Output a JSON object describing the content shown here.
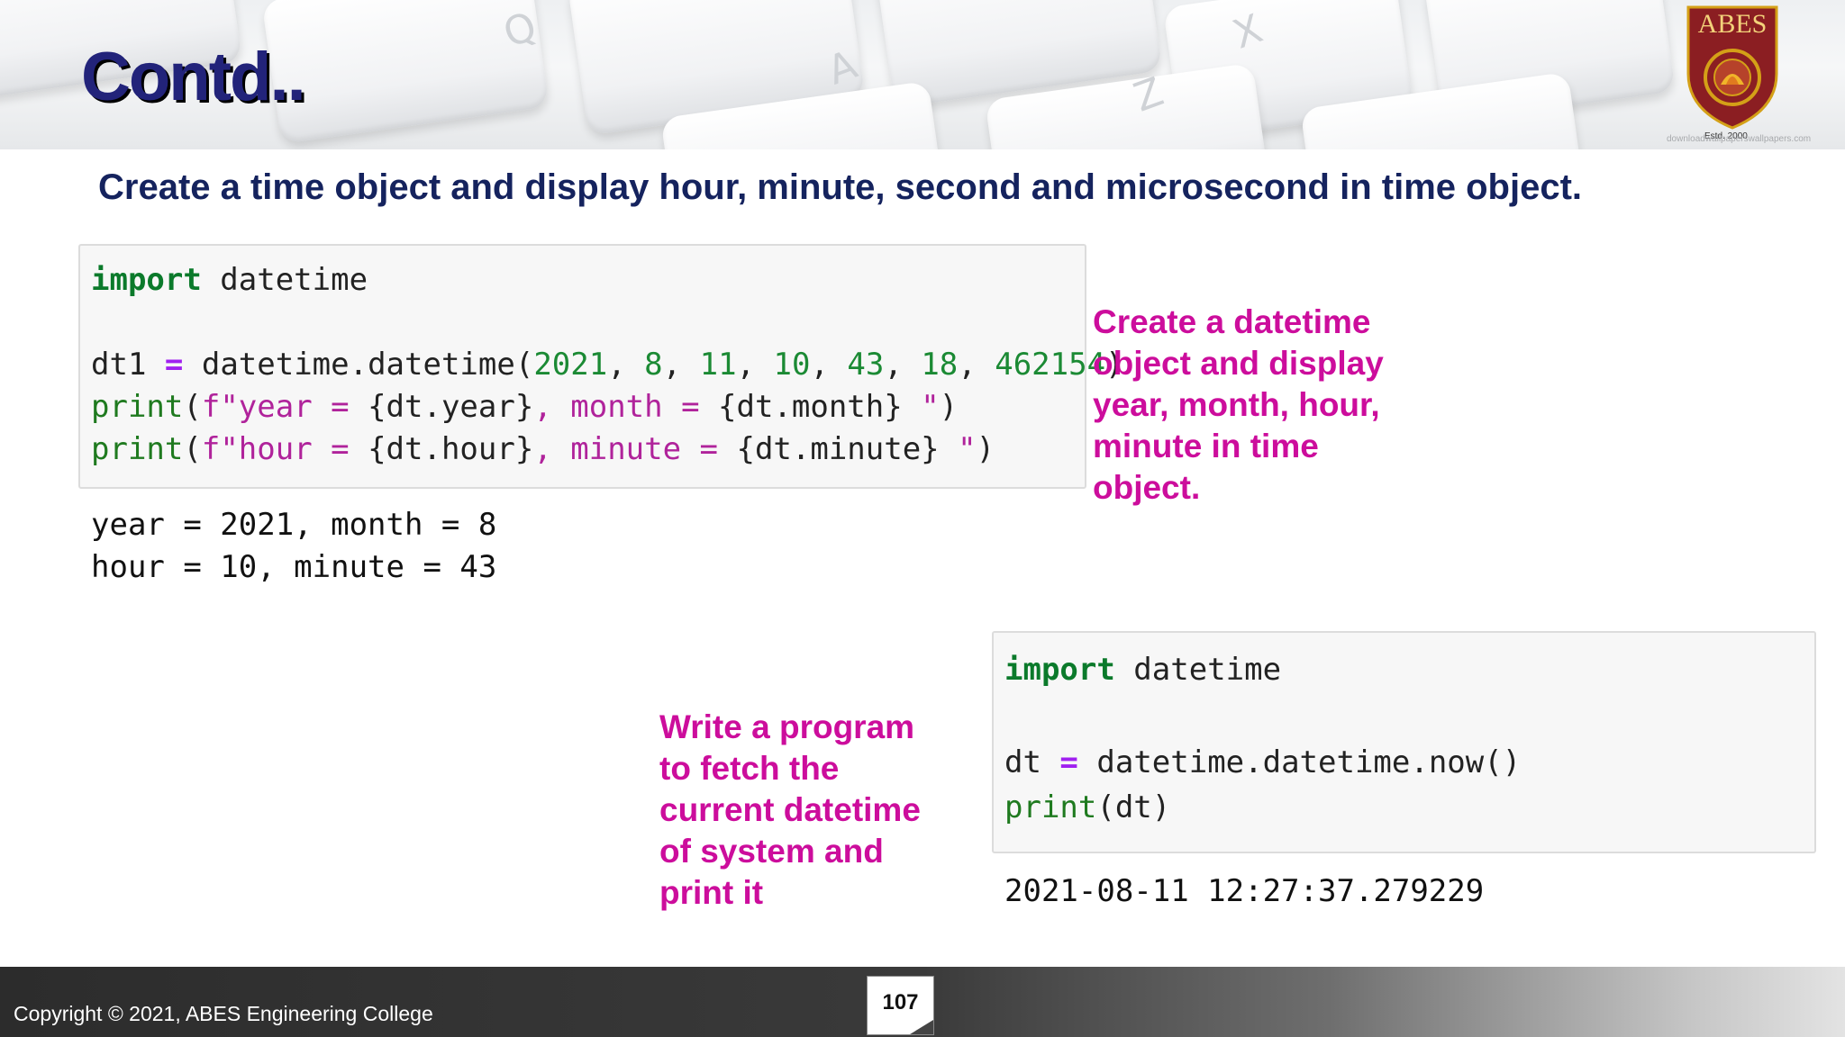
{
  "header": {
    "title": "Contd..",
    "logo_text": "ABES",
    "logo_est": "Estd. 2000",
    "watermark": "downloadwallpaperswallpapers.com"
  },
  "question": "Create a time object and display hour, minute, second and microsecond in time object.",
  "block1": {
    "code_lines": [
      "import datetime",
      "",
      "dt1 = datetime.datetime(2021, 8, 11, 10, 43, 18, 462154)",
      "print(f\"year = {dt.year}, month = {dt.month} \")",
      "print(f\"hour = {dt.hour}, minute = {dt.minute} \")"
    ],
    "output_lines": [
      "year = 2021, month = 8",
      "hour = 10, minute = 43"
    ],
    "note": "Create a datetime object and display year, month, hour, minute in time object."
  },
  "block2": {
    "code_lines": [
      "import datetime",
      "",
      "dt = datetime.datetime.now()",
      "print(dt)"
    ],
    "output_lines": [
      "2021-08-11 12:27:37.279229"
    ],
    "note": "Write a program to fetch the current datetime of system and print it"
  },
  "footer": {
    "copyright": "Copyright © 2021, ABES Engineering College",
    "page_number": "107"
  },
  "colors": {
    "title": "#22237a",
    "question": "#15235e",
    "note": "#cc0d9c",
    "keyword": "#0b7a2b",
    "string": "#b0239b"
  }
}
